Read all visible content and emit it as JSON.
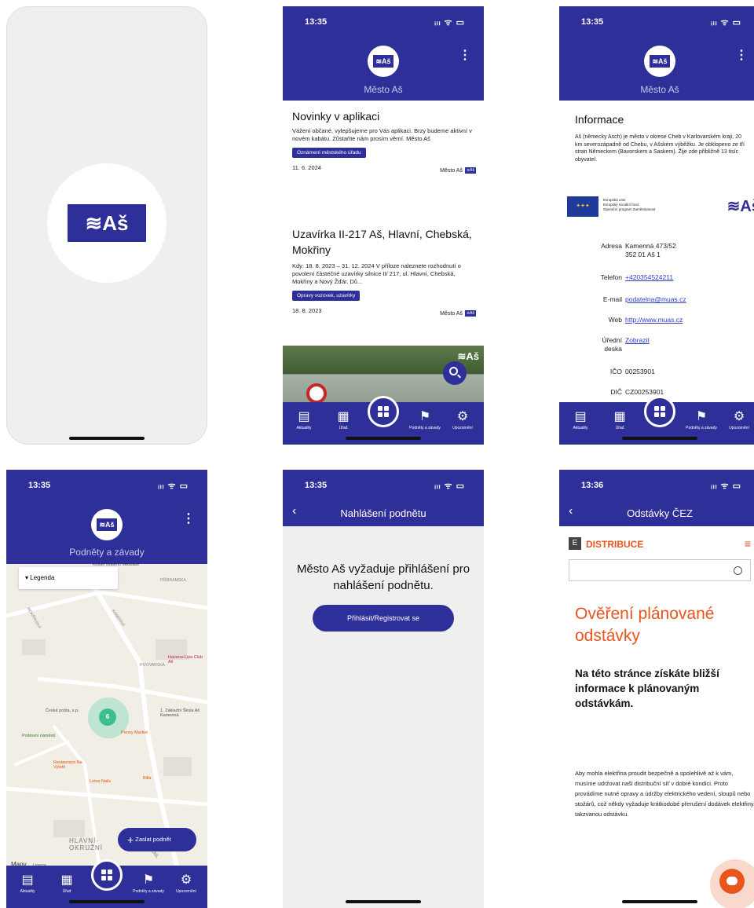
{
  "brand": {
    "logo_text": "≋Aš",
    "color": "#2e2f98"
  },
  "status_bar": {
    "time_a": "13:35",
    "time_b": "13:36",
    "signal": "ᵢₗₗ ᯤ ▭"
  },
  "tabs": {
    "news": "Aktuality",
    "office": "Úřad",
    "reports": "Podněty a závady",
    "alerts": "Upozornění"
  },
  "screen2": {
    "header_title": "Město Aš",
    "news": [
      {
        "title": "Novinky v aplikaci",
        "text": "Vážení občané, vylepšujeme pro Vás aplikaci. Brzy budeme aktivní v novém kabátu. Zůstaňte nám prosím věrní. Město Aš",
        "chip": "Oznámení městského úřadu",
        "date": "11. 6. 2024",
        "source": "Město Aš",
        "tag": "≋Aš"
      },
      {
        "title": "Uzavírka II-217 Aš, Hlavní, Chebská, Mokřiny",
        "text": "Kdy: 18. 8. 2023 – 31. 12. 2024 V příloze naleznete rozhodnutí o povolení částečné uzavírky silnice II/ 217, ul. Hlavní, Chebská, Mokřiny a Nový Žďár. Dů...",
        "chip": "Opravy vozovek, uzavírky",
        "date": "18. 8. 2023",
        "source": "Město Aš",
        "tag": "≋Aš"
      }
    ]
  },
  "screen3": {
    "header_title": "Město Aš",
    "heading": "Informace",
    "intro": "Aš (německy Asch) je město v okrese Cheb v Karlovarském kraji, 20 km severozápadně od Chebu, v Ašském výběžku. Je obklopeno ze tří stran Německem (Bavorskem a Saskem). Žije zde přibližně 13 tisíc obyvatel.",
    "eu_lines": [
      "Evropská unie",
      "Evropský sociální fond",
      "Operační program Zaměstnanost"
    ],
    "rows": [
      {
        "label": "Adresa",
        "value": "Kamenná 473/52\n352 01 Aš 1",
        "link": false
      },
      {
        "label": "Telefon",
        "value": "+420354524211",
        "link": true
      },
      {
        "label": "E-mail",
        "value": "podatelna@muas.cz",
        "link": true
      },
      {
        "label": "Web",
        "value": "http://www.muas.cz",
        "link": true
      },
      {
        "label": "Úřední\ndeska",
        "value": "Zobrazit",
        "link": true
      },
      {
        "label": "IČO",
        "value": "00253901",
        "link": false
      },
      {
        "label": "DIČ",
        "value": "CZ00253901",
        "link": false
      }
    ]
  },
  "screen4": {
    "header_title": "Podněty a závady",
    "legend": "Legenda",
    "cluster": "6",
    "fab": "Zaslat podnět",
    "map_brand": "Mapy",
    "license": "Licence",
    "map_labels": {
      "post": "Česká pošta, s.p.",
      "square": "Poštovní náměstí",
      "penny": "Penny Market",
      "school": "1. Základní Škola Aš Kamenná",
      "restaurant": "Restaurace Na Výletě",
      "lotus": "Lotus Nails",
      "billa": "Billa",
      "havana": "Havana-Lipa Club Aš",
      "church": "Kostel svatého Mikuláše",
      "street1": "PŘÍBRAMSKÁ",
      "street2": "PIVOVARSKÁ",
      "street3": "KAMENNÁ",
      "street4": "HLAVNÍ-OKRUŽNÍ",
      "street5": "NORTH TRAIL",
      "street6": "MOKŘINSKÁ"
    }
  },
  "screen5": {
    "title": "Nahlášení podnětu",
    "message": "Město Aš vyžaduje přihlášení pro nahlášení podnětu.",
    "button": "Přihlásit/Registrovat se"
  },
  "screen6": {
    "title": "Odstávky ČEZ",
    "brand": "DISTRIBUCE",
    "heading": "Ověření plánované odstávky",
    "subheading": "Na této stránce získáte bližší informace k plánovaným odstávkám.",
    "paragraph": "Aby mohla elektřina proudit bezpečně a spolehlivě až k vám, musíme udržovat naši distribuční síť v dobré kondici. Proto provádíme nutné opravy a údržby elektrického vedení, sloupů nebo stožárů, což někdy vyžaduje krátkodobé přerušení dodávek elektřiny, takzvanou odstávku."
  }
}
